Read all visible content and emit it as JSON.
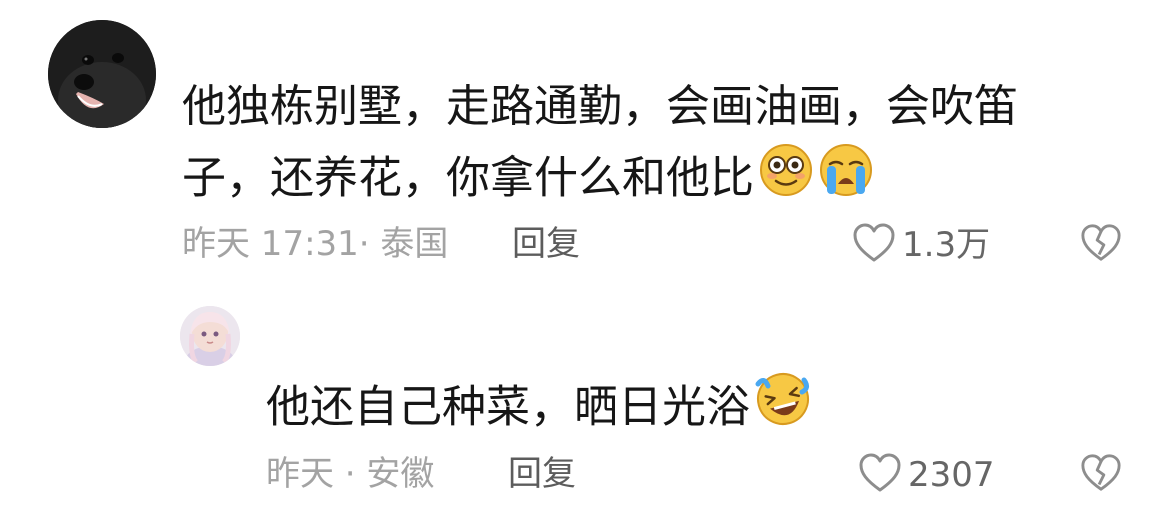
{
  "comments": [
    {
      "avatar": "dog-avatar",
      "text_lines": [
        "他独栋别墅，走路通勤，会画油画，会吹笛",
        "子，还养花，你拿什么和他比"
      ],
      "emojis": [
        "dazed-face-emoji",
        "crying-face-emoji"
      ],
      "meta": "昨天 17:31· 泰国",
      "reply_label": "回复",
      "like_count": "1.3万"
    },
    {
      "avatar": "anime-girl-avatar",
      "text": "他还自己种菜，晒日光浴",
      "emojis": [
        "rolling-laughing-emoji"
      ],
      "meta": "昨天 · 安徽",
      "reply_label": "回复",
      "like_count": "2307"
    }
  ]
}
